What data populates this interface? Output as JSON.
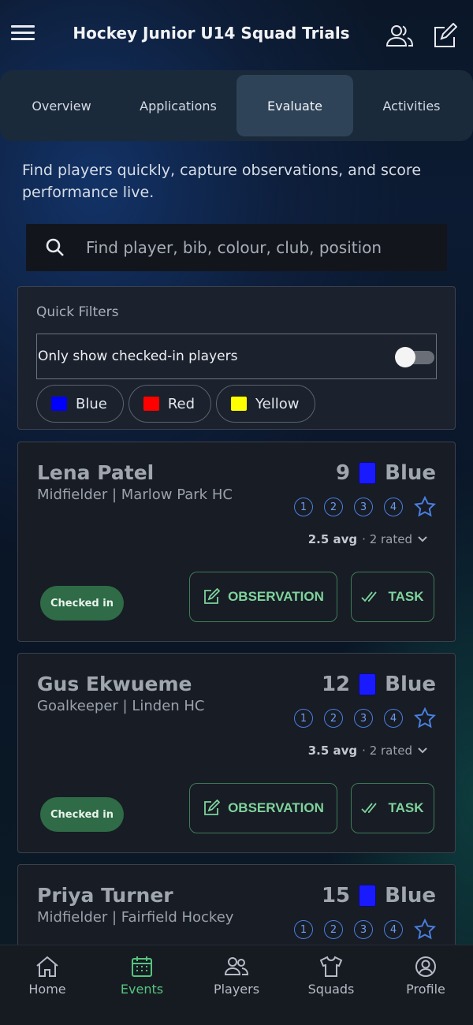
{
  "header": {
    "title": "Hockey Junior U14 Squad Trials",
    "menu_icon": "hamburger-menu-icon",
    "people_icon": "people-icon",
    "edit_icon": "edit-icon"
  },
  "tabs": [
    {
      "label": "Overview",
      "active": false
    },
    {
      "label": "Applications",
      "active": false
    },
    {
      "label": "Evaluate",
      "active": true
    },
    {
      "label": "Activities",
      "active": false
    }
  ],
  "intro": "Find players quickly, capture observations, and score performance live.",
  "search": {
    "placeholder": "Find player, bib, colour, club, position",
    "value": ""
  },
  "filters": {
    "title": "Quick Filters",
    "checked_in_label": "Only show checked-in players",
    "checked_in_enabled": false,
    "chips": [
      {
        "label": "Blue",
        "color": "#0000ff"
      },
      {
        "label": "Red",
        "color": "#ff0000"
      },
      {
        "label": "Yellow",
        "color": "#ffff00"
      }
    ]
  },
  "players": [
    {
      "name": "Lena Patel",
      "position": "Midfielder | Marlow Park HC",
      "bib": "9",
      "team": "Blue",
      "team_color": "#1a1aff",
      "ratings": [
        "1",
        "2",
        "3",
        "4"
      ],
      "avg": "2.5 avg",
      "rated": "· 2 rated",
      "status": "Checked in",
      "observation_label": "OBSERVATION",
      "task_label": "TASK"
    },
    {
      "name": "Gus Ekwueme",
      "position": "Goalkeeper | Linden HC",
      "bib": "12",
      "team": "Blue",
      "team_color": "#1a1aff",
      "ratings": [
        "1",
        "2",
        "3",
        "4"
      ],
      "avg": "3.5 avg",
      "rated": "· 2 rated",
      "status": "Checked in",
      "observation_label": "OBSERVATION",
      "task_label": "TASK"
    },
    {
      "name": "Priya Turner",
      "position": "Midfielder | Fairfield Hockey",
      "bib": "15",
      "team": "Blue",
      "team_color": "#1a1aff",
      "ratings": [
        "1",
        "2",
        "3",
        "4"
      ]
    }
  ],
  "bottom_nav": [
    {
      "label": "Home",
      "icon": "home-icon",
      "active": false
    },
    {
      "label": "Events",
      "icon": "calendar-icon",
      "active": true
    },
    {
      "label": "Players",
      "icon": "players-icon",
      "active": false
    },
    {
      "label": "Squads",
      "icon": "shirt-icon",
      "active": false
    },
    {
      "label": "Profile",
      "icon": "profile-icon",
      "active": false
    }
  ],
  "colors": {
    "accent_green": "#56c47e",
    "rating_blue": "#4a7fe0",
    "badge_green": "#2e6b46"
  }
}
